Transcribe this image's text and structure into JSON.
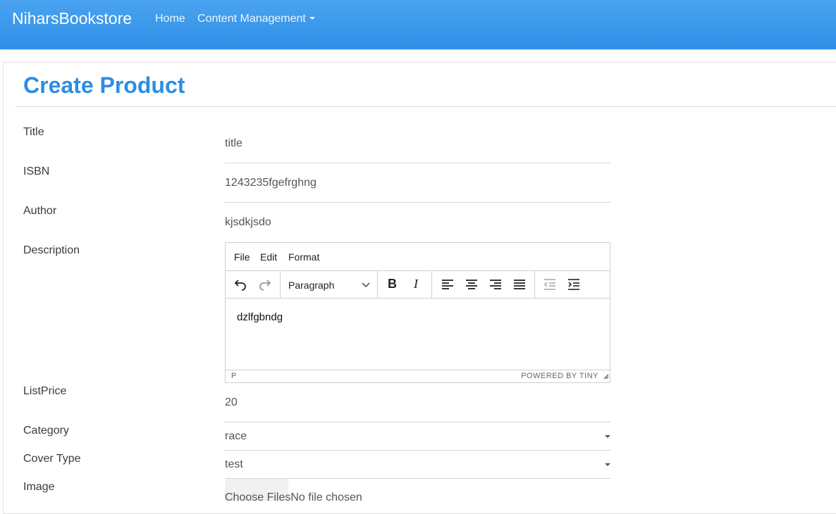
{
  "navbar": {
    "brand": "NiharsBookstore",
    "links": [
      "Home",
      "Content Management"
    ]
  },
  "page": {
    "title": "Create Product"
  },
  "form": {
    "title_label": "Title",
    "title_placeholder": "title",
    "isbn_label": "ISBN",
    "isbn_value": "1243235fgefrghng",
    "author_label": "Author",
    "author_value": "kjsdkjsdo",
    "description_label": "Description",
    "listprice_label": "ListPrice",
    "listprice_value": "20",
    "category_label": "Category",
    "category_value": "race",
    "covertype_label": "Cover Type",
    "covertype_value": "test",
    "image_label": "Image",
    "file_button": "Choose Files",
    "file_status": "No file chosen"
  },
  "editor": {
    "menu": [
      "File",
      "Edit",
      "Format"
    ],
    "block_format": "Paragraph",
    "toolbar_icons": [
      "undo-icon",
      "redo-icon",
      "bold-icon",
      "italic-icon",
      "align-left-icon",
      "align-center-icon",
      "align-right-icon",
      "align-justify-icon",
      "outdent-icon",
      "indent-icon"
    ],
    "content": "dzlfgbndg",
    "status_path": "P",
    "powered_by": "POWERED BY TINY"
  },
  "colors": {
    "navbar": "#3399ee",
    "title": "#2c8de5"
  }
}
